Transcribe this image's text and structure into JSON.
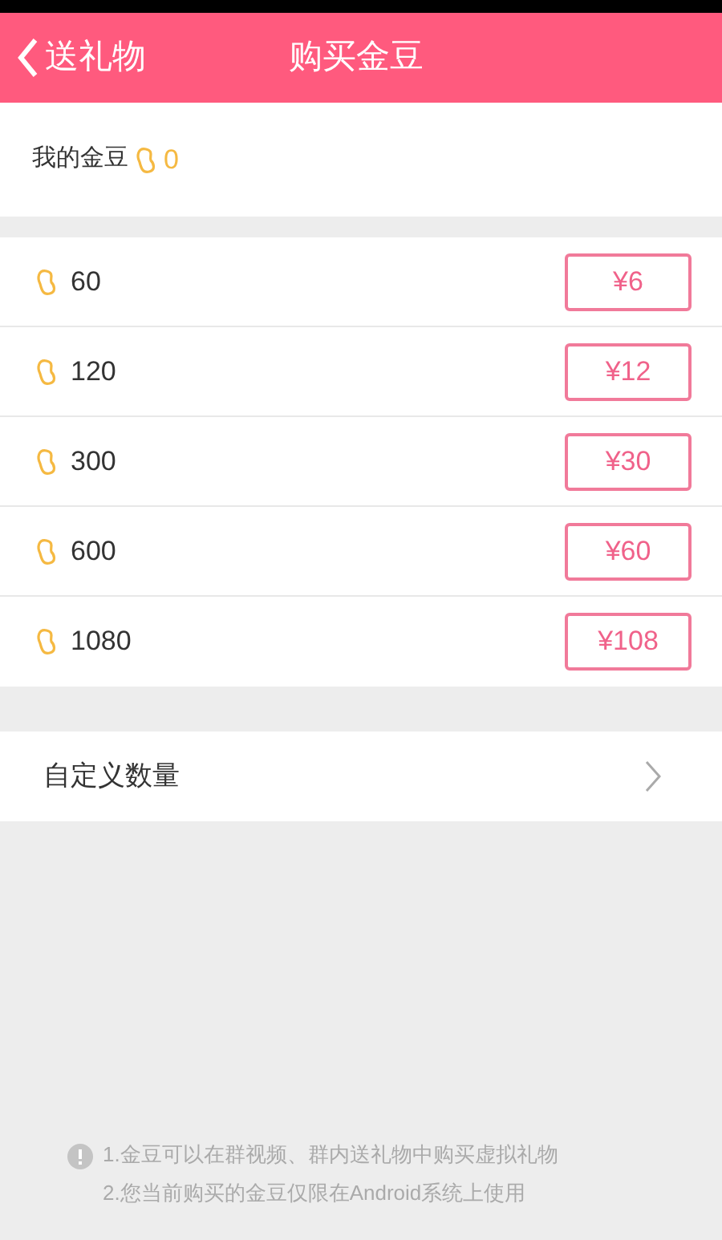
{
  "header": {
    "back_label": "送礼物",
    "title": "购买金豆"
  },
  "balance": {
    "label": "我的金豆",
    "amount": "0"
  },
  "packages": [
    {
      "amount": "60",
      "price": "¥6"
    },
    {
      "amount": "120",
      "price": "¥12"
    },
    {
      "amount": "300",
      "price": "¥30"
    },
    {
      "amount": "600",
      "price": "¥60"
    },
    {
      "amount": "1080",
      "price": "¥108"
    }
  ],
  "custom": {
    "label": "自定义数量"
  },
  "notes": [
    "1.金豆可以在群视频、群内送礼物中购买虚拟礼物",
    "2.您当前购买的金豆仅限在Android系统上使用"
  ]
}
